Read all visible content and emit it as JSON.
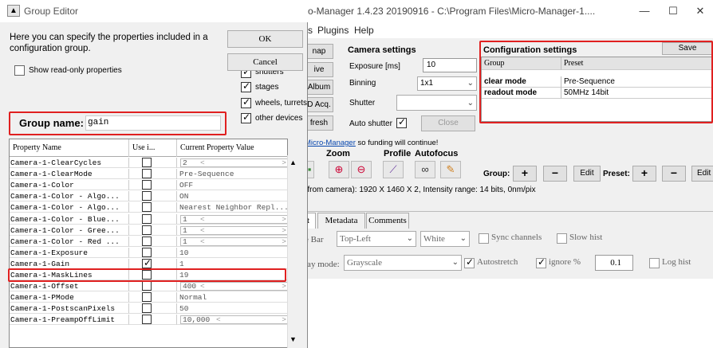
{
  "main_window": {
    "title": "o-Manager 1.4.23 20190916 - C:\\Program Files\\Micro-Manager-1....",
    "minimize": "—",
    "maximize": "☐",
    "close": "✕",
    "menus": [
      "s",
      "Plugins",
      "Help"
    ],
    "left_buttons": [
      "nap",
      "ive",
      "Album",
      "D Acq.",
      "fresh"
    ],
    "camera": {
      "heading": "Camera settings",
      "exposure_label": "Exposure [ms]",
      "exposure_value": "10",
      "binning_label": "Binning",
      "binning_value": "1x1",
      "shutter_label": "Shutter",
      "shutter_value": "",
      "auto_shutter_label": "Auto shutter",
      "close_label": "Close"
    },
    "funding_link": "Micro-Manager",
    "funding_text": " so funding will continue!",
    "zoom_label": "Zoom",
    "profile_label": "Profile",
    "autofocus_label": "Autofocus",
    "group_label": "Group:",
    "preset_label": "Preset:",
    "plus": "+",
    "minus": "−",
    "edit": "Edit",
    "status_line": "(from camera): 1920 X 1460 X 2, Intensity range: 14 bits, 0nm/pix",
    "tabs": [
      "t",
      "Metadata",
      "Comments"
    ],
    "bar_label": "e Bar",
    "bar_position": "Top-Left",
    "bar_color": "White",
    "sync_channels": "Sync channels",
    "slow_hist": "Slow hist",
    "display_mode_label": "lay mode:",
    "display_mode_value": "Grayscale",
    "autostretch": "Autostretch",
    "ignore": "ignore %",
    "ignore_value": "0.1",
    "log_hist": "Log hist"
  },
  "config": {
    "heading": "Configuration settings",
    "save_label": "Save",
    "col_group": "Group",
    "col_preset": "Preset",
    "rows": [
      {
        "group": "clear mode",
        "preset": "Pre-Sequence"
      },
      {
        "group": "readout mode",
        "preset": "50MHz 14bit"
      }
    ]
  },
  "dialog": {
    "title": "Group Editor",
    "description": "Here you can specify the properties included in a configuration group.",
    "ok_label": "OK",
    "cancel_label": "Cancel",
    "show_readonly_label": "Show read-only properties",
    "filter_shutters": "shutters",
    "filter_stages": "stages",
    "filter_wheels": "wheels, turrets, etc.",
    "filter_other": "other devices",
    "group_name_label": "Group name:",
    "group_name_value": "gain",
    "col_property": "Property Name",
    "col_use": "Use i...",
    "col_value": "Current Property Value",
    "properties": [
      {
        "name": "Camera-1-ClearCycles",
        "use": false,
        "value": "2",
        "kind": "slider"
      },
      {
        "name": "Camera-1-ClearMode",
        "use": false,
        "value": "Pre-Sequence",
        "kind": "text"
      },
      {
        "name": "Camera-1-Color",
        "use": false,
        "value": "OFF",
        "kind": "text"
      },
      {
        "name": "Camera-1-Color - Algo...",
        "use": false,
        "value": "ON",
        "kind": "text"
      },
      {
        "name": "Camera-1-Color - Algo...",
        "use": false,
        "value": "Nearest Neighbor Repl...",
        "kind": "text"
      },
      {
        "name": "Camera-1-Color - Blue...",
        "use": false,
        "value": "1",
        "kind": "slider"
      },
      {
        "name": "Camera-1-Color - Gree...",
        "use": false,
        "value": "1",
        "kind": "slider"
      },
      {
        "name": "Camera-1-Color - Red ...",
        "use": false,
        "value": "1",
        "kind": "slider"
      },
      {
        "name": "Camera-1-Exposure",
        "use": false,
        "value": "10",
        "kind": "text"
      },
      {
        "name": "Camera-1-Gain",
        "use": true,
        "value": "1",
        "kind": "text"
      },
      {
        "name": "Camera-1-MaskLines",
        "use": false,
        "value": "19",
        "kind": "text"
      },
      {
        "name": "Camera-1-Offset",
        "use": false,
        "value": "400",
        "kind": "slider"
      },
      {
        "name": "Camera-1-PMode",
        "use": false,
        "value": "Normal",
        "kind": "text"
      },
      {
        "name": "Camera-1-PostscanPixels",
        "use": false,
        "value": "50",
        "kind": "text"
      },
      {
        "name": "Camera-1-PreampOffLimit",
        "use": false,
        "value": "10,000",
        "kind": "slider"
      }
    ]
  },
  "colors": {
    "highlight": "#e02020",
    "link": "#0645ad"
  }
}
